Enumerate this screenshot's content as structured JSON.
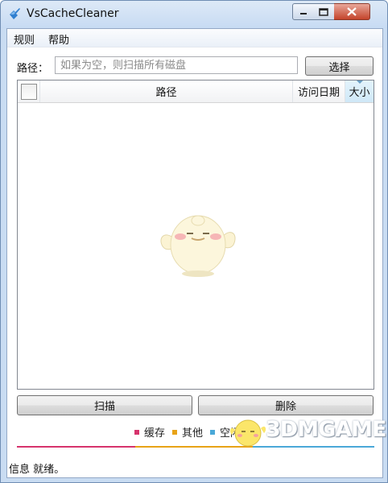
{
  "window": {
    "title": "VsCacheCleaner",
    "icon": "app-icon",
    "controls": {
      "minimize": "minimize-icon",
      "maximize": "maximize-icon",
      "close": "close-icon"
    }
  },
  "menu": {
    "rules": "规则",
    "help": "帮助"
  },
  "path": {
    "label": "路径：",
    "placeholder": "如果为空，则扫描所有磁盘",
    "value": "",
    "select_button": "选择"
  },
  "list": {
    "columns": {
      "path": "路径",
      "access_date": "访问日期",
      "size": "大小"
    },
    "rows": []
  },
  "actions": {
    "scan": "扫描",
    "delete": "删除"
  },
  "legend": [
    {
      "label": "缓存",
      "color": "#d6336c"
    },
    {
      "label": "其他",
      "color": "#e8a317"
    },
    {
      "label": "空闲",
      "color": "#4aa8d8"
    }
  ],
  "progress": {
    "cache": 0.33,
    "other": 0.33,
    "free": 0.34
  },
  "status": {
    "label": "信息",
    "text": "就绪。"
  },
  "watermark": {
    "text": "3DMGAME"
  }
}
